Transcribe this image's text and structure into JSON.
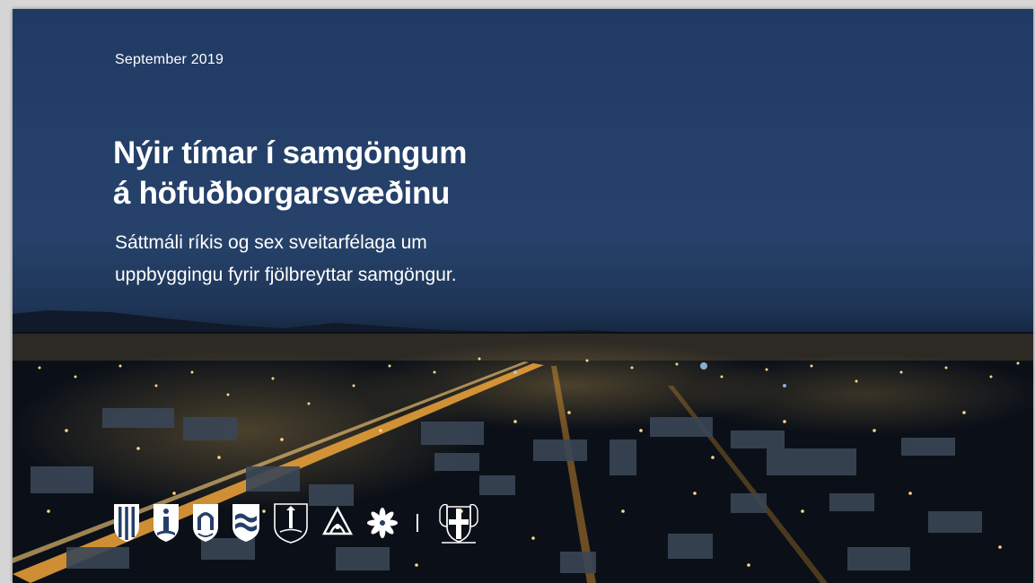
{
  "slide": {
    "date": "September 2019",
    "title_lines": [
      "Nýir tímar í samgöngum",
      "á höfuðborgarsvæðinu"
    ],
    "subtitle_lines": [
      "Sáttmáli ríkis og sex sveitarfélaga um",
      "uppbyggingu fyrir fjölbreyttar samgöngur."
    ]
  },
  "logos": [
    "municipal-crest-1-icon",
    "municipal-crest-2-icon",
    "municipal-crest-3-icon",
    "municipal-crest-4-icon",
    "municipal-crest-5-icon",
    "municipal-crest-6-icon",
    "municipal-crest-7-icon",
    "iceland-coat-of-arms-icon"
  ],
  "colors": {
    "sky": "#243f68",
    "text": "#ffffff",
    "city_light": "#f5b24a"
  }
}
